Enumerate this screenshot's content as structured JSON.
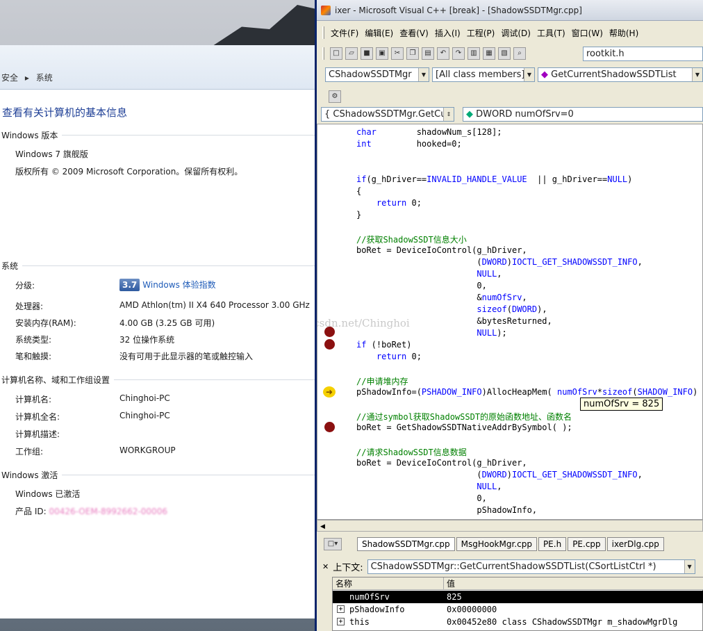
{
  "sys": {
    "breadcrumb": [
      "安全",
      "系统"
    ],
    "title": "查看有关计算机的基本信息",
    "edition": {
      "header": "Windows 版本",
      "name": "Windows 7 旗舰版",
      "copyright": "版权所有 © 2009 Microsoft Corporation。保留所有权利。"
    },
    "system": {
      "header": "系统",
      "rating_label": "分级:",
      "rating_score": "3.7",
      "rating_link": "Windows 体验指数",
      "cpu_label": "处理器:",
      "cpu": "AMD Athlon(tm) II X4 640 Processor   3.00 GHz",
      "ram_label": "安装内存(RAM):",
      "ram": "4.00 GB (3.25 GB 可用)",
      "type_label": "系统类型:",
      "type": "32 位操作系统",
      "pen_label": "笔和触摸:",
      "pen": "没有可用于此显示器的笔或触控输入"
    },
    "computer": {
      "header": "计算机名称、域和工作组设置",
      "name_label": "计算机名:",
      "name": "Chinghoi-PC",
      "full_label": "计算机全名:",
      "full": "Chinghoi-PC",
      "desc_label": "计算机描述:",
      "group_label": "工作组:",
      "group": "WORKGROUP"
    },
    "activation": {
      "header": "Windows 激活",
      "status": "Windows 已激活",
      "pid_label": "产品 ID:",
      "pid": "00426-OEM-8992662-00006"
    }
  },
  "vc": {
    "title": "ixer - Microsoft Visual C++ [break] - [ShadowSSDTMgr.cpp]",
    "menu": [
      "文件(F)",
      "编辑(E)",
      "查看(V)",
      "插入(I)",
      "工程(P)",
      "调试(D)",
      "工具(T)",
      "窗口(W)",
      "帮助(H)"
    ],
    "find_box": "rootkit.h",
    "class_combo": "CShadowSSDTMgr",
    "filter_combo": "[All class members]",
    "member_combo": "GetCurrentShadowSSDTList",
    "func_combo": "CShadowSSDTMgr.GetCu",
    "var_combo": "DWORD numOfSrv=0",
    "tooltip": "numOfSrv = 825",
    "watermark": "http://blog.csdn.net/Chinghoi",
    "tabs": [
      "ShadowSSDTMgr.cpp",
      "MsgHookMgr.cpp",
      "PE.h",
      "PE.cpp",
      "ixerDlg.cpp"
    ],
    "context_label": "上下文:",
    "context_value": "CShadowSSDTMgr::GetCurrentShadowSSDTList(CSortListCtrl *)",
    "watch": {
      "col_name": "名称",
      "col_value": "值",
      "rows": [
        {
          "name": "numOfSrv",
          "value": "825"
        },
        {
          "name": "pShadowInfo",
          "value": "0x00000000"
        },
        {
          "name": "this",
          "value": "0x00452e80 class CShadowSSDTMgr m_shadowMgrDlg"
        }
      ]
    }
  }
}
